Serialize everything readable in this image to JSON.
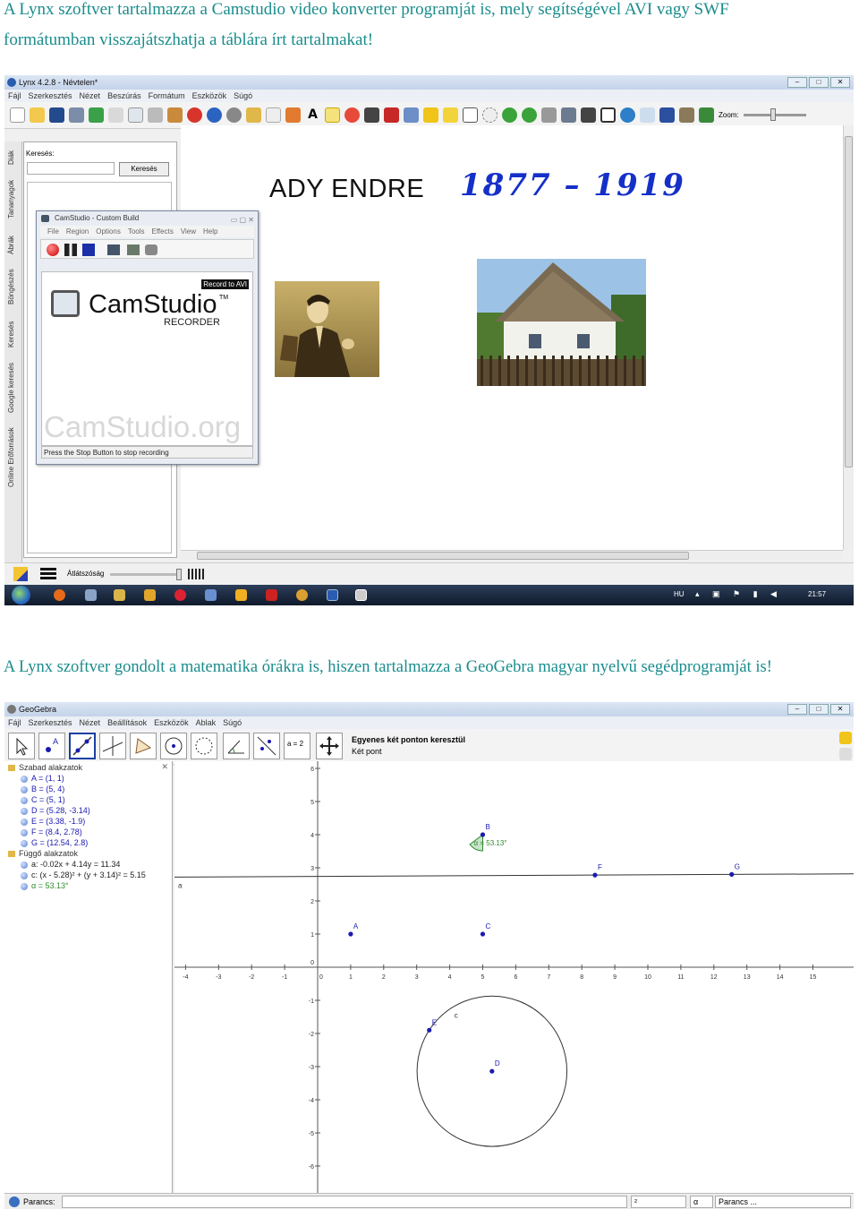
{
  "captions": {
    "first": "A Lynx szoftver tartalmazza a Camstudio video konverter programját is, mely segítségével AVI vagy SWF formátumban visszajátszhatja a táblára írt tartalmakat!",
    "second": "A Lynx szoftver gondolt a matematika órákra is, hiszen tartalmazza a GeoGebra magyar nyelvű segédprogramját is!"
  },
  "lynx": {
    "title": "Lynx 4.2.8 - Névtelen*",
    "menu": [
      "Fájl",
      "Szerkesztés",
      "Nézet",
      "Beszúrás",
      "Formátum",
      "Eszközök",
      "Súgó"
    ],
    "zoom_label": "Zoom:",
    "side_tabs": [
      "Diák",
      "Tananyagok",
      "Ábrák",
      "Böngészés",
      "Keresés",
      "Google keresés",
      "Online Erőforrások"
    ],
    "search_label": "Keresés:",
    "search_button": "Keresés",
    "board_text": "ADY ENDRE",
    "board_years": "1877 – 1919",
    "transparency_label": "Átlátszóság",
    "taskbar": {
      "lang": "HU",
      "time": "21:57"
    }
  },
  "camstudio": {
    "title": "CamStudio - Custom Build",
    "menu": [
      "File",
      "Region",
      "Options",
      "Tools",
      "Effects",
      "View",
      "Help"
    ],
    "badge": "Record to AVI",
    "brand": "CamStudio",
    "tm": "TM",
    "recorder": "RECORDER",
    "watermark": "CamStudio.org",
    "status": "Press the Stop Button to stop recording"
  },
  "geogebra": {
    "title": "GeoGebra",
    "menu": [
      "Fájl",
      "Szerkesztés",
      "Nézet",
      "Beállítások",
      "Eszközök",
      "Ablak",
      "Súgó"
    ],
    "tool_title": "Egyenes két ponton keresztül",
    "tool_subtitle": "Két pont",
    "slider_tool_label": "a = 2",
    "free_header": "Szabad alakzatok",
    "free_objects": [
      "A = (1, 1)",
      "B = (5, 4)",
      "C = (5, 1)",
      "D = (5.28, -3.14)",
      "E = (3.38, -1.9)",
      "F = (8.4, 2.78)",
      "G = (12.54, 2.8)"
    ],
    "dependent_header": "Függő alakzatok",
    "dependent_objects": [
      "a: -0.02x + 4.14y = 11.34",
      "c: (x - 5.28)² + (y + 3.14)² = 5.15",
      "α = 53.13°"
    ],
    "angle_label": "α = 53.13°",
    "line_label": "a",
    "circle_label": "c",
    "command_label": "Parancs:",
    "bottom_select_1": "²",
    "bottom_select_2": "α",
    "bottom_select_3": "Parancs ...",
    "x_ticks": [
      "-4",
      "-3",
      "-2",
      "-1",
      "0",
      "1",
      "2",
      "3",
      "4",
      "5",
      "6",
      "7",
      "8",
      "9",
      "10",
      "11",
      "12",
      "13",
      "14",
      "15"
    ],
    "y_ticks": [
      "6",
      "5",
      "4",
      "3",
      "2",
      "1",
      "0",
      "-1",
      "-2",
      "-3",
      "-4",
      "-5",
      "-6"
    ],
    "points": [
      {
        "name": "A",
        "x": 1,
        "y": 1
      },
      {
        "name": "B",
        "x": 5,
        "y": 4
      },
      {
        "name": "C",
        "x": 5,
        "y": 1
      },
      {
        "name": "D",
        "x": 5.28,
        "y": -3.14
      },
      {
        "name": "E",
        "x": 3.38,
        "y": -1.9
      },
      {
        "name": "F",
        "x": 8.4,
        "y": 2.78
      },
      {
        "name": "G",
        "x": 12.54,
        "y": 2.8
      }
    ],
    "circle": {
      "cx": 5.28,
      "cy": -3.14,
      "r2": 5.15
    },
    "colors": {
      "point": "#1a1ab0",
      "angle_fill": "#2e8b2e"
    }
  }
}
